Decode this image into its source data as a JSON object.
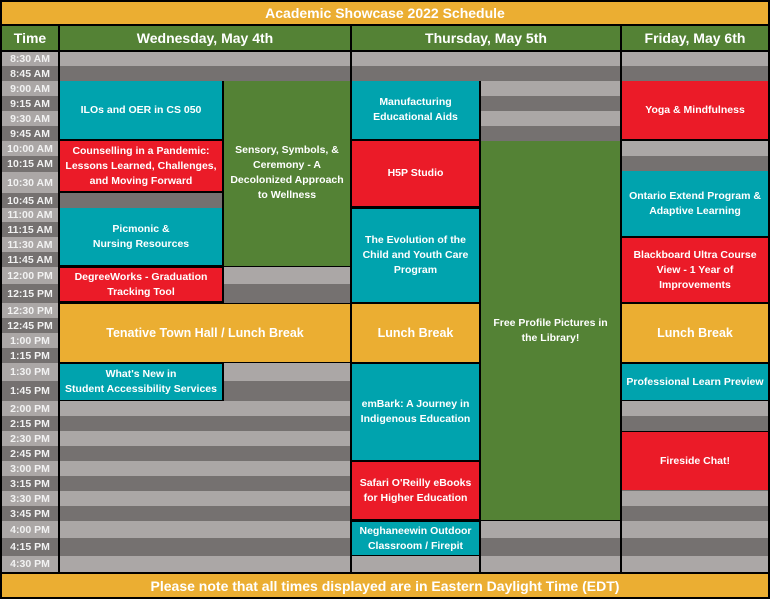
{
  "title": "Academic Showcase 2022 Schedule",
  "footer": "Please note that all times displayed are in Eastern Daylight Time (EDT)",
  "headers": {
    "time": "Time",
    "wednesday": "Wednesday, May 4th",
    "thursday": "Thursday, May 5th",
    "friday": "Friday, May 6th"
  },
  "colors": {
    "gold": "#EBAE32",
    "green": "#548235",
    "teal": "#00A3AE",
    "red": "#EB1B28",
    "gray_light": "#ABA7A6",
    "gray_dark": "#757170"
  },
  "times": [
    "8:30 AM",
    "8:45 AM",
    "9:00 AM",
    "9:15 AM",
    "9:30 AM",
    "9:45 AM",
    "10:00 AM",
    "10:15 AM",
    "10:30 AM",
    "10:45 AM",
    "11:00 AM",
    "11:15 AM",
    "11:30 AM",
    "11:45 AM",
    "12:00 PM",
    "12:15 PM",
    "12:30 PM",
    "12:45 PM",
    "1:00 PM",
    "1:15 PM",
    "1:30 PM",
    "1:45 PM",
    "2:00 PM",
    "2:15 PM",
    "2:30 PM",
    "2:45 PM",
    "3:00 PM",
    "3:15 PM",
    "3:30 PM",
    "3:45 PM",
    "4:00 PM",
    "4:15 PM",
    "4:30 PM"
  ],
  "events": {
    "wed_ilos": "ILOs and OER in CS 050",
    "wed_counselling": "Counselling in a Pandemic:\nLessons Learned, Challenges, and Moving Forward",
    "wed_sensory": "Sensory, Symbols, & Ceremony - A Decolonized Approach to Wellness",
    "wed_picmonic": "Picmonic &\nNursing Resources",
    "wed_degreeworks": "DegreeWorks - Graduation Tracking Tool",
    "wed_townhall": "Tenative Town Hall / Lunch Break",
    "wed_whatsnew": "What's New in\nStudent Accessibility Services",
    "thu_manufacturing": "Manufacturing\nEducational Aids",
    "thu_h5p": "H5P Studio",
    "thu_evolution": "The Evolution of the Child and Youth Care Program",
    "thu_lunch": "Lunch Break",
    "thu_embark": "emBark: A Journey in Indigenous Education",
    "thu_safari": "Safari O'Reilly eBooks for Higher Education",
    "thu_neghaneewin": "Neghaneewin Outdoor Classroom / Firepit",
    "thu_profile": "Free Profile Pictures in the Library!",
    "fri_yoga": "Yoga & Mindfulness",
    "fri_ontario": "Ontario Extend Program & Adaptive Learning",
    "fri_blackboard": "Blackboard Ultra Course View - 1 Year of Improvements",
    "fri_lunch": "Lunch Break",
    "fri_professional": "Professional Learn Preview",
    "fri_fireside": "Fireside Chat!"
  }
}
